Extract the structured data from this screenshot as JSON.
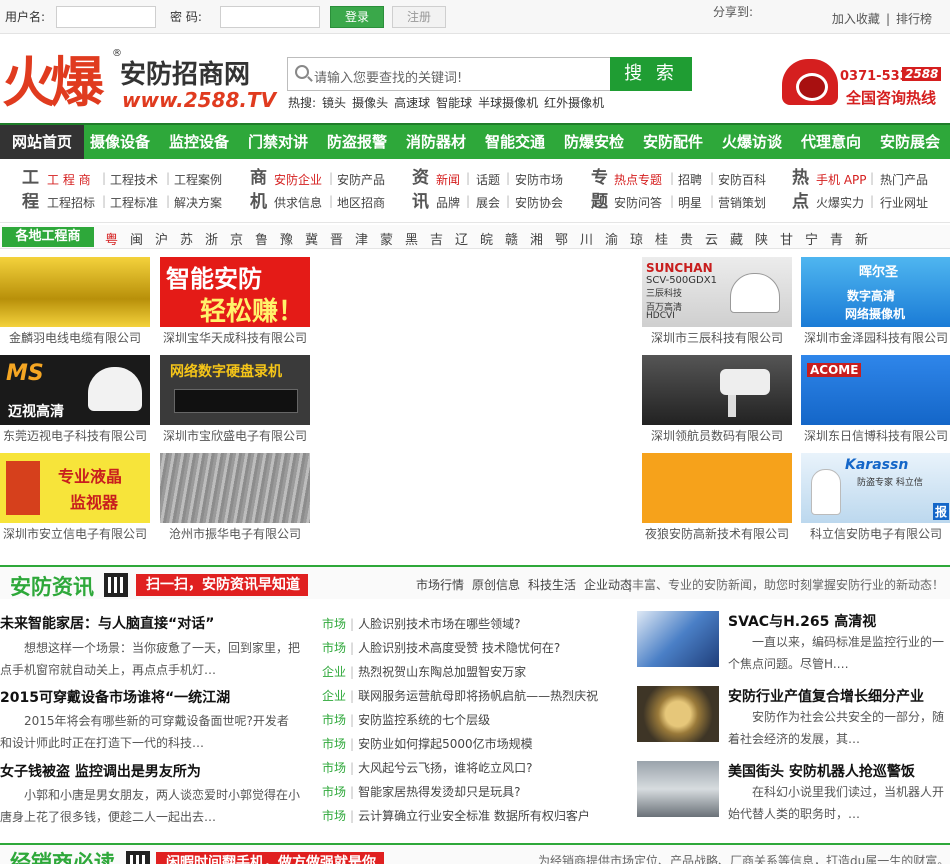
{
  "topbar": {
    "username_label": "用户名:",
    "password_label": "密 码:",
    "login": "登录",
    "register": "注册",
    "share": "分享到:",
    "fav": "加入收藏",
    "rank": "排行榜"
  },
  "logo": {
    "fire": "火爆",
    "name": "安防招商网",
    "url": "www.2588.TV",
    "reg": "®"
  },
  "search": {
    "placeholder": "请输入您要查找的关键词!",
    "button": "搜 索",
    "hot_label": "热搜:",
    "hot": [
      "镜头",
      "摄像头",
      "高速球",
      "智能球",
      "半球摄像机",
      "红外摄像机"
    ]
  },
  "hotline": {
    "number": "0371-5339",
    "badge": "2588",
    "text": "全国咨询热线"
  },
  "nav": [
    "网站首页",
    "摄像设备",
    "监控设备",
    "门禁对讲",
    "防盗报警",
    "消防器材",
    "智能交通",
    "防爆安检",
    "安防配件",
    "火爆访谈",
    "代理意向",
    "安防展会"
  ],
  "subnav": {
    "g1": {
      "title": [
        "工",
        "程"
      ],
      "row1": [
        "工 程 商",
        "工程技术",
        "工程案例"
      ],
      "row2": [
        "工程招标",
        "工程标准",
        "解决方案"
      ]
    },
    "g2": {
      "title": [
        "商",
        "机"
      ],
      "row1": [
        "安防企业",
        "安防产品"
      ],
      "row2": [
        "供求信息",
        "地区招商"
      ]
    },
    "g3": {
      "title": [
        "资",
        "讯"
      ],
      "row1": [
        "新闻",
        "话题",
        "安防市场"
      ],
      "row2": [
        "品牌",
        "展会",
        "安防协会"
      ]
    },
    "g4": {
      "title": [
        "专",
        "题"
      ],
      "row1": [
        "热点专题",
        "招聘",
        "安防百科"
      ],
      "row2": [
        "安防问答",
        "明星",
        "营销策划"
      ]
    },
    "g5": {
      "title": [
        "热",
        "点"
      ],
      "row1": [
        "手机 APP",
        "热门产品"
      ],
      "row2": [
        "火爆实力",
        "行业网址"
      ]
    }
  },
  "region": {
    "tag": "各地工程商",
    "items": [
      "粤",
      "闽",
      "沪",
      "苏",
      "浙",
      "京",
      "鲁",
      "豫",
      "冀",
      "晋",
      "津",
      "蒙",
      "黑",
      "吉",
      "辽",
      "皖",
      "赣",
      "湘",
      "鄂",
      "川",
      "渝",
      "琼",
      "桂",
      "贵",
      "云",
      "藏",
      "陕",
      "甘",
      "宁",
      "青",
      "新"
    ]
  },
  "ads": {
    "a1": {
      "cap": "金麟羽电线电缆有限公司"
    },
    "a2": {
      "cap": "深圳宝华天成科技有限公司",
      "text1": "智能安防",
      "text2": "轻松赚！"
    },
    "a3": {
      "cap": "深圳市三辰科技有限公司",
      "brand": "SUNCHAN",
      "model": "SCV-500GDX1",
      "lines": [
        "三辰科技",
        "百万高清",
        "HDCVI"
      ]
    },
    "a4": {
      "cap": "深圳市金泽园科技有限公司",
      "brand": "晖尔圣",
      "text1": "数字高清",
      "text2": "网络摄像机"
    },
    "a5": {
      "cap": "东莞迈视电子科技有限公司",
      "brand": "MS",
      "text": "迈视高清"
    },
    "a6": {
      "cap": "深圳市宝欣盛电子有限公司",
      "text": "网络数字硬盘录机"
    },
    "a7": {
      "cap": "深圳领航员数码有限公司"
    },
    "a8": {
      "cap": "深圳东日信博科技有限公司",
      "brand": "ACOME"
    },
    "a9": {
      "cap": "深圳市安立信电子有限公司",
      "text1": "专业液晶",
      "text2": "监视器"
    },
    "a10": {
      "cap": "沧州市振华电子有限公司"
    },
    "a11": {
      "cap": "夜狼安防高新技术有限公司"
    },
    "a12": {
      "cap": "科立信安防电子有限公司",
      "brand": "Karassn",
      "slogan": "防盗专家 科立信",
      "tag": "报"
    }
  },
  "news": {
    "title": "安防资讯",
    "badge": "扫一扫，安防资讯早知道",
    "links": [
      "市场行情",
      "原创信息",
      "科技生活",
      "企业动态"
    ],
    "desc": "|丰富、专业的安防新闻，助您时刻掌握安防行业的新动态！",
    "articles": [
      {
        "title": "未来智能家居：与人脑直接“对话”",
        "summary": "想想这样一个场景：当你疲惫了一天，回到家里，把点手机窗帘就自动关上，再点点手机灯…"
      },
      {
        "title": "2015可穿戴设备市场谁将“一统江湖",
        "summary": "2015年将会有哪些新的可穿戴设备面世呢?开发者和设计师此时正在打造下一代的科技…"
      },
      {
        "title": "女子钱被盗 监控调出是男友所为",
        "summary": "小郭和小唐是男女朋友，两人谈恋爱时小郭觉得在小唐身上花了很多钱，便趁二人一起出去…"
      }
    ],
    "list": [
      {
        "cat": "市场",
        "title": "人脸识别技术市场在哪些领域?"
      },
      {
        "cat": "市场",
        "title": "人脸识别技术高度受赞 技术隐忧何在?"
      },
      {
        "cat": "企业",
        "title": "热烈祝贺山东陶总加盟智安万家"
      },
      {
        "cat": "企业",
        "title": "联网服务运营航母即将扬帆启航——热烈庆祝"
      },
      {
        "cat": "市场",
        "title": "安防监控系统的七个层级"
      },
      {
        "cat": "市场",
        "title": "安防业如何撑起5000亿市场规模"
      },
      {
        "cat": "市场",
        "title": "大风起兮云飞扬，谁将屹立风口?"
      },
      {
        "cat": "市场",
        "title": "智能家居热得发烫却只是玩具?"
      },
      {
        "cat": "市场",
        "title": "云计算确立行业安全标准 数据所有权归客户"
      }
    ],
    "pics": [
      {
        "title": "SVAC与H.265 高清视",
        "summary": "一直以来，编码标准是监控行业的一个焦点问题。尽管H.…"
      },
      {
        "title": "安防行业产值复合增长细分产业",
        "summary": "安防作为社会公共安全的一部分，随着社会经济的发展，其…"
      },
      {
        "title": "美国街头 安防机器人抢巡警饭",
        "summary": "在科幻小说里我们读过，当机器人开始代替人类的职务时，…"
      }
    ]
  },
  "next": {
    "title": "经销商必读",
    "badge": "闲暇时间翻手机，做方做强就是你",
    "desc": "为经销商提供市场定位、产品战略、厂商关系等信息，打造du属一生的财富。"
  }
}
